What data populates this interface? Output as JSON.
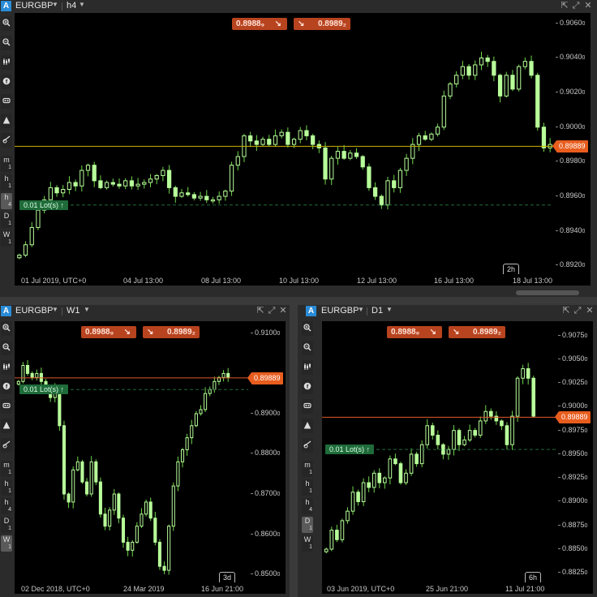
{
  "colors": {
    "bull": "#b8ff9a",
    "wick": "#6fd64a",
    "price_line_top": "#c8b400",
    "price_line_bottom": "#e0582a",
    "badge": "#e85d1e",
    "trade_btn": "#b8431f",
    "lots": "#1f6b3a",
    "accent": "#2a8bd6"
  },
  "tools": [
    {
      "name": "zoom-in-icon"
    },
    {
      "name": "zoom-out-icon"
    },
    {
      "name": "chart-type-icon"
    },
    {
      "name": "indicators-icon"
    },
    {
      "name": "templates-icon"
    },
    {
      "name": "drawings-icon"
    },
    {
      "name": "settings-icon"
    }
  ],
  "timeframes": [
    {
      "main": "m",
      "sub": "1"
    },
    {
      "main": "h",
      "sub": "1"
    },
    {
      "main": "h",
      "sub": "4"
    },
    {
      "main": "D",
      "sub": "1"
    },
    {
      "main": "W",
      "sub": "1"
    }
  ],
  "charts": {
    "top": {
      "logo": "A",
      "symbol": "EURGBP",
      "timeframe": "h4",
      "sell_price": "0.8988₉",
      "buy_price": "0.8989₂",
      "sell_arrow": "↘",
      "buy_arrow": "↘",
      "lots": "0.01 Lot(s) ↑",
      "current_price": "0.89889",
      "period_label": "2h",
      "selected_tf": 2,
      "yticks": [
        "0.9060",
        "0.9040",
        "0.9020",
        "0.9000",
        "0.8980",
        "0.8960",
        "0.8940",
        "0.8920"
      ],
      "yticks_sup": [
        "0",
        "0",
        "0",
        "0",
        "0",
        "0",
        "0",
        "0"
      ],
      "xticks": [
        "01 Jul 2019, UTC+0",
        "04 Jul 13:00",
        "08 Jul 13:00",
        "10 Jul 13:00",
        "12 Jul 13:00",
        "16 Jul 13:00",
        "18 Jul 13:00"
      ],
      "y_range": [
        0.8915,
        0.9066
      ],
      "chart_data": {
        "type": "candlestick",
        "ylim": [
          0.8915,
          0.9066
        ],
        "current_price": 0.89889,
        "lots_level": 0.8955,
        "closes": [
          0.8926,
          0.8932,
          0.8942,
          0.8952,
          0.8958,
          0.8965,
          0.8962,
          0.8964,
          0.8968,
          0.8966,
          0.8975,
          0.8978,
          0.8969,
          0.8965,
          0.8968,
          0.8967,
          0.8966,
          0.8969,
          0.8966,
          0.8967,
          0.8968,
          0.897,
          0.8972,
          0.8975,
          0.8965,
          0.896,
          0.8962,
          0.8961,
          0.8959,
          0.896,
          0.8958,
          0.8958,
          0.896,
          0.8963,
          0.8978,
          0.8983,
          0.8995,
          0.8992,
          0.899,
          0.8993,
          0.899,
          0.8995,
          0.8997,
          0.899,
          0.8993,
          0.8998,
          0.8995,
          0.899,
          0.8988,
          0.897,
          0.8982,
          0.8986,
          0.8982,
          0.8985,
          0.8983,
          0.8977,
          0.8965,
          0.896,
          0.8955,
          0.8969,
          0.8965,
          0.8975,
          0.8982,
          0.899,
          0.8995,
          0.8993,
          0.8996,
          0.9,
          0.9018,
          0.9025,
          0.903,
          0.9035,
          0.903,
          0.9036,
          0.904,
          0.9038,
          0.903,
          0.9018,
          0.903,
          0.9022,
          0.9035,
          0.9038,
          0.903,
          0.9,
          0.8988,
          0.899
        ]
      }
    },
    "left": {
      "logo": "A",
      "symbol": "EURGBP",
      "timeframe": "W1",
      "sell_price": "0.8988₉",
      "buy_price": "0.8989₂",
      "sell_arrow": "↘",
      "buy_arrow": "↘",
      "lots": "0.01 Lot(s) ↑",
      "current_price": "0.89889",
      "period_label": "3d",
      "selected_tf": 4,
      "yticks": [
        "0.9100",
        "0.8900",
        "0.8800",
        "0.8700",
        "0.8600",
        "0.8500"
      ],
      "yticks_sup": [
        "0",
        "0",
        "0",
        "0",
        "0",
        "0"
      ],
      "xticks": [
        "02 Dec 2018, UTC+0",
        "24 Mar 2019",
        "16 Jun 21:00"
      ],
      "y_range": [
        0.848,
        0.913
      ],
      "chart_data": {
        "type": "candlestick",
        "ylim": [
          0.848,
          0.913
        ],
        "current_price": 0.89889,
        "lots_level": 0.896,
        "closes": [
          0.898,
          0.902,
          0.9,
          0.899,
          0.9,
          0.898,
          0.896,
          0.894,
          0.896,
          0.887,
          0.87,
          0.868,
          0.876,
          0.878,
          0.873,
          0.87,
          0.878,
          0.873,
          0.865,
          0.862,
          0.866,
          0.87,
          0.864,
          0.858,
          0.856,
          0.858,
          0.862,
          0.865,
          0.868,
          0.864,
          0.858,
          0.852,
          0.851,
          0.862,
          0.872,
          0.878,
          0.881,
          0.884,
          0.887,
          0.89,
          0.891,
          0.895,
          0.896,
          0.898,
          0.899,
          0.9,
          0.899
        ]
      }
    },
    "right": {
      "logo": "A",
      "symbol": "EURGBP",
      "timeframe": "D1",
      "sell_price": "0.8988₉",
      "buy_price": "0.8989₂",
      "sell_arrow": "↘",
      "buy_arrow": "↘",
      "lots": "0.01 Lot(s) ↑",
      "current_price": "0.89889",
      "period_label": "6h",
      "selected_tf": 3,
      "yticks": [
        "0.9075",
        "0.9050",
        "0.9025",
        "0.9000",
        "0.8975",
        "0.8950",
        "0.8925",
        "0.8900",
        "0.8875",
        "0.8850",
        "0.8825"
      ],
      "yticks_sup": [
        "0",
        "0",
        "0",
        "0",
        "0",
        "0",
        "0",
        "0",
        "0",
        "0",
        "0"
      ],
      "xticks": [
        "03 Jun 2019, UTC+0",
        "25 Jun 21:00",
        "11 Jul 21:00"
      ],
      "y_range": [
        0.8815,
        0.909
      ],
      "chart_data": {
        "type": "candlestick",
        "ylim": [
          0.8815,
          0.909
        ],
        "current_price": 0.89889,
        "lots_level": 0.8955,
        "closes": [
          0.885,
          0.887,
          0.886,
          0.888,
          0.889,
          0.891,
          0.89,
          0.892,
          0.8915,
          0.893,
          0.892,
          0.8925,
          0.8945,
          0.894,
          0.892,
          0.893,
          0.895,
          0.894,
          0.896,
          0.898,
          0.897,
          0.896,
          0.895,
          0.8955,
          0.8975,
          0.896,
          0.8965,
          0.8975,
          0.897,
          0.8985,
          0.8995,
          0.899,
          0.8985,
          0.898,
          0.896,
          0.899,
          0.903,
          0.904,
          0.903,
          0.899
        ]
      }
    }
  }
}
